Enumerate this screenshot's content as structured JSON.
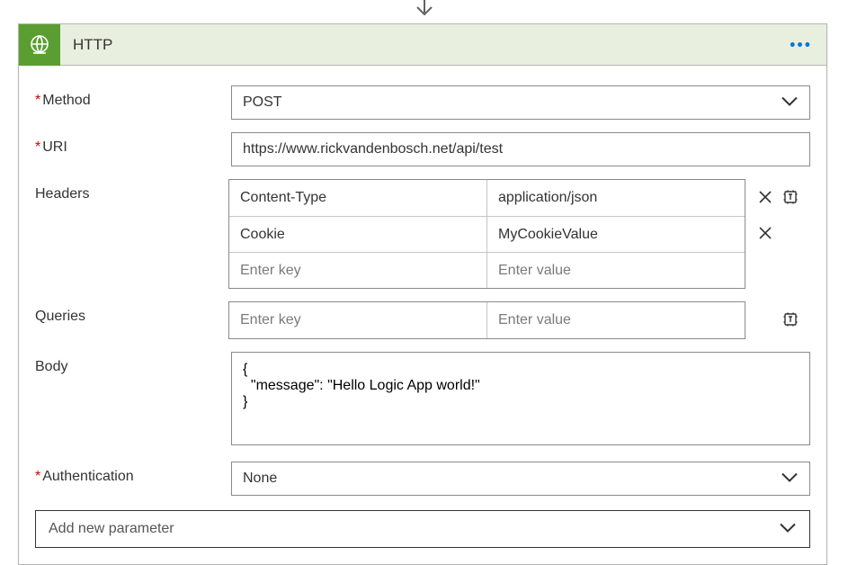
{
  "connector": {
    "title": "HTTP"
  },
  "fields": {
    "method": {
      "label": "Method",
      "value": "POST"
    },
    "uri": {
      "label": "URI",
      "value": "https://www.rickvandenbosch.net/api/test"
    },
    "headers": {
      "label": "Headers",
      "key_placeholder": "Enter key",
      "value_placeholder": "Enter value",
      "rows": [
        {
          "key": "Content-Type",
          "value": "application/json"
        },
        {
          "key": "Cookie",
          "value": "MyCookieValue"
        }
      ]
    },
    "queries": {
      "label": "Queries",
      "key_placeholder": "Enter key",
      "value_placeholder": "Enter value"
    },
    "body": {
      "label": "Body",
      "value": "{\n  \"message\": \"Hello Logic App world!\"\n}"
    },
    "authentication": {
      "label": "Authentication",
      "value": "None"
    },
    "add_param": "Add new parameter"
  }
}
